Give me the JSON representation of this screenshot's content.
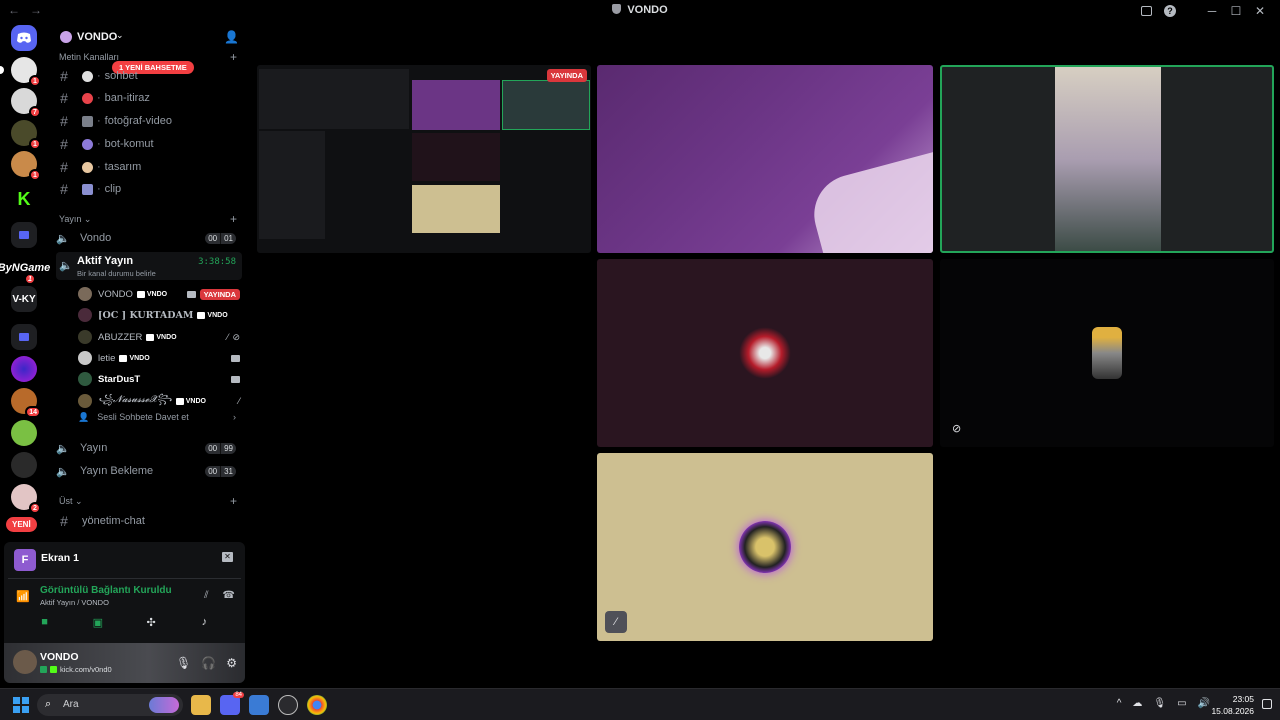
{
  "window": {
    "title": "VONDO"
  },
  "server": {
    "name": "VONDO",
    "mention_pill": "1 YENİ BAHSETME",
    "new_pill": "YENİ"
  },
  "rail": {
    "badges": [
      "1",
      "7",
      "1",
      "1",
      "1",
      "14",
      "2"
    ],
    "text_servers": [
      "ByNGame",
      "V-KY"
    ]
  },
  "categories": {
    "text": "Metin Kanalları",
    "stream": "Yayın",
    "top": "Üst"
  },
  "text_channels": [
    {
      "name": "sohbet"
    },
    {
      "name": "ban-itiraz"
    },
    {
      "name": "fotoğraf-video"
    },
    {
      "name": "bot-komut"
    },
    {
      "name": "tasarım"
    },
    {
      "name": "clip"
    }
  ],
  "voice_channels": {
    "vondo": {
      "name": "Vondo",
      "count_a": "00",
      "count_b": "01"
    },
    "active": {
      "name": "Aktif Yayın",
      "sub": "Bir kanal durumu belirle",
      "timer": "3:38:58"
    },
    "yayin": {
      "name": "Yayın",
      "count_a": "00",
      "count_b": "99"
    },
    "bekleme": {
      "name": "Yayın Bekleme",
      "count_a": "00",
      "count_b": "31"
    },
    "yonetim": {
      "name": "yönetim-chat"
    }
  },
  "voice_users": [
    {
      "name": "VONDO",
      "tag": "VNDO",
      "live": "YAYINDA"
    },
    {
      "name": "[OC ] KURTADAM",
      "tag": "VNDO"
    },
    {
      "name": "ABUZZER",
      "tag": "VNDO"
    },
    {
      "name": "letie",
      "tag": "VNDO"
    },
    {
      "name": "StarDusT",
      "tag": ""
    },
    {
      "name": "꧁𝓝𝓪𝓼𝓾𝓼𝓼𝓮𝓧꧂",
      "tag": "VNDO"
    }
  ],
  "invite": "Sesli Sohbete Davet et",
  "voice_panel": {
    "screen_initial": "F",
    "screen_title": "Ekran 1",
    "status": "Görüntülü Bağlantı Kuruldu",
    "where": "Aktif Yayın / VONDO"
  },
  "user_panel": {
    "name": "VONDO",
    "sub": "kick.com/v0nd0"
  },
  "stage": {
    "live_label": "YAYINDA"
  },
  "taskbar": {
    "search_placeholder": "Ara",
    "discord_badge": "84",
    "time": "23:05",
    "date": "15.08.2026"
  },
  "colors": {
    "accent_green": "#23a559",
    "danger": "#f23f42",
    "blurple": "#5865f2"
  }
}
